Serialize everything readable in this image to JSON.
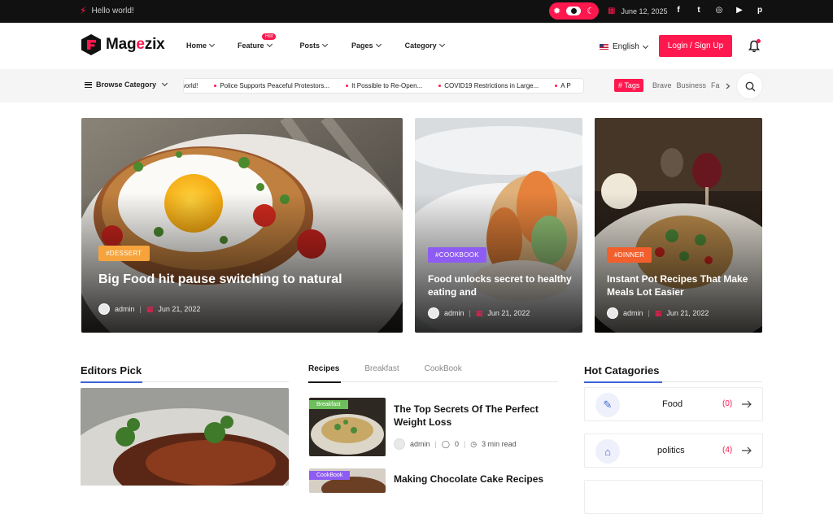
{
  "topbar": {
    "greeting": "Hello world!",
    "date": "June 12, 2025",
    "social_icons": [
      "facebook-icon",
      "twitter-icon",
      "instagram-icon",
      "youtube-icon",
      "pinterest-icon"
    ],
    "social_glyphs": [
      "f",
      "t",
      "◎",
      "▶",
      "p"
    ]
  },
  "header": {
    "logo_main": "Mag",
    "logo_accent": "e",
    "logo_rest": "zix",
    "nav": [
      {
        "label": "Home"
      },
      {
        "label": "Feature",
        "badge": "Hot"
      },
      {
        "label": "Posts"
      },
      {
        "label": "Pages"
      },
      {
        "label": "Category"
      }
    ],
    "language": "English",
    "login_label": "Login / Sign Up"
  },
  "catbar": {
    "browse_label": "Browse Category",
    "ticker": [
      "world!",
      "Police Supports Peaceful Protestors...",
      "It Possible to Re-Open...",
      "COVID19 Restrictions in Large...",
      "A P"
    ],
    "tags_label": "# Tags",
    "tags": [
      "Brave",
      "Business",
      "Fa"
    ]
  },
  "hero": [
    {
      "badge": "#DESSERT",
      "title": "Big Food hit pause switching to natural",
      "author": "admin",
      "date": "Jun 21, 2022"
    },
    {
      "badge": "#COOKBOOK",
      "title": "Food unlocks secret to healthy eating and",
      "author": "admin",
      "date": "Jun 21, 2022"
    },
    {
      "badge": "#DINNER",
      "title": "Instant Pot Recipes That Make Meals Lot Easier",
      "author": "admin",
      "date": "Jun 21, 2022"
    }
  ],
  "colors": {
    "accent": "#ff184e",
    "dessert": "#f6a33c",
    "cookbook": "#8f5cf3",
    "dinner": "#f25f2c",
    "blue": "#3d63d9"
  },
  "editors_pick": {
    "title": "Editors Pick"
  },
  "recipes": {
    "tabs": [
      "Recipes",
      "Breakfast",
      "CookBook"
    ],
    "items": [
      {
        "tag": "Breakfast",
        "title": "The Top Secrets Of The Perfect Weight Loss",
        "author": "admin",
        "comments": "0",
        "read": "3 min read"
      },
      {
        "tag": "CookBook",
        "title": "Making Chocolate Cake Recipes"
      }
    ]
  },
  "hot_categories": {
    "title": "Hot Catagories",
    "items": [
      {
        "name": "Food",
        "count": "(0)",
        "icon": "food-icon"
      },
      {
        "name": "politics",
        "count": "(4)",
        "icon": "bank-icon"
      }
    ]
  }
}
